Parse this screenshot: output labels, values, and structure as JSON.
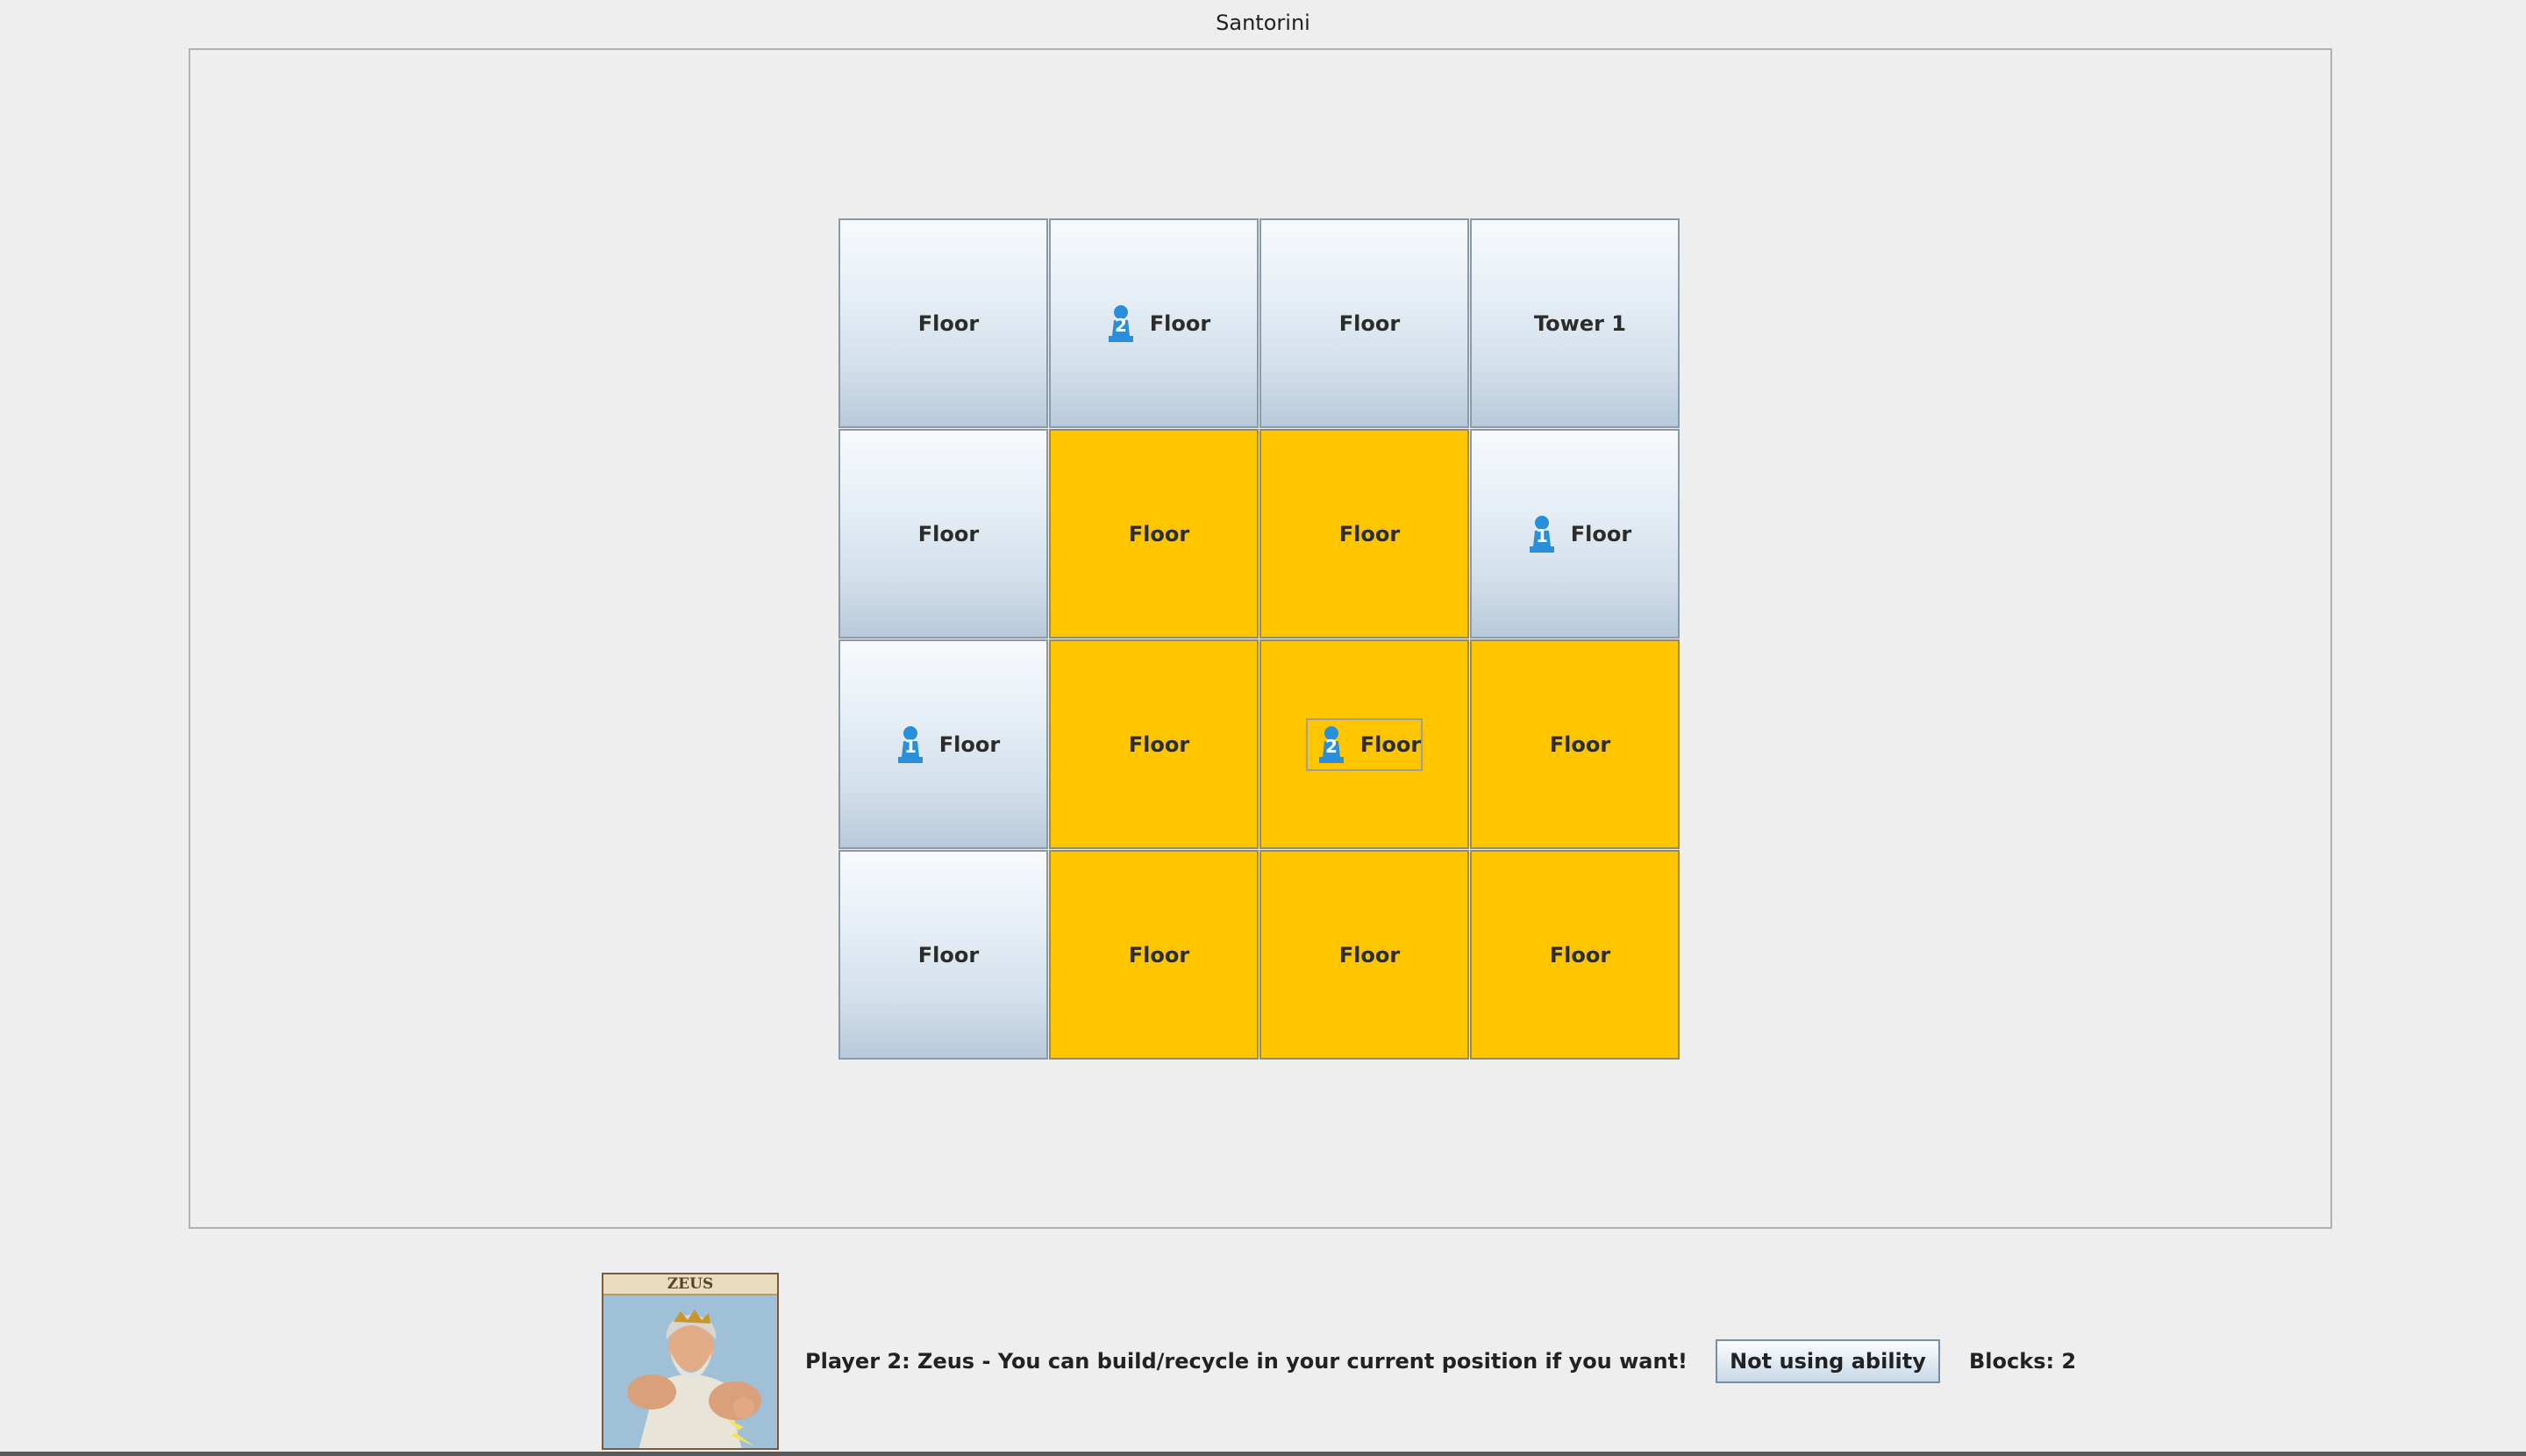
{
  "window": {
    "title": "Santorini"
  },
  "board": {
    "rows": [
      [
        {
          "label": "Floor",
          "highlight": false,
          "worker": null
        },
        {
          "label": "Floor",
          "highlight": false,
          "worker": "2"
        },
        {
          "label": "Floor",
          "highlight": false,
          "worker": null
        },
        {
          "label": "Tower 1",
          "highlight": false,
          "worker": null
        }
      ],
      [
        {
          "label": "Floor",
          "highlight": false,
          "worker": null
        },
        {
          "label": "Floor",
          "highlight": true,
          "worker": null
        },
        {
          "label": "Floor",
          "highlight": true,
          "worker": null
        },
        {
          "label": "Floor",
          "highlight": false,
          "worker": "1"
        }
      ],
      [
        {
          "label": "Floor",
          "highlight": false,
          "worker": "1"
        },
        {
          "label": "Floor",
          "highlight": true,
          "worker": null
        },
        {
          "label": "Floor",
          "highlight": true,
          "worker": "2",
          "selected": true
        },
        {
          "label": "Floor",
          "highlight": true,
          "worker": null
        }
      ],
      [
        {
          "label": "Floor",
          "highlight": false,
          "worker": null
        },
        {
          "label": "Floor",
          "highlight": true,
          "worker": null
        },
        {
          "label": "Floor",
          "highlight": true,
          "worker": null
        },
        {
          "label": "Floor",
          "highlight": true,
          "worker": null
        }
      ]
    ]
  },
  "colors": {
    "highlight": "#ffc600",
    "worker": "#2a8fd8"
  },
  "footer": {
    "god_card": {
      "name": "ZEUS",
      "icon": "zeus-card-image"
    },
    "status": "Player 2: Zeus - You can build/recycle in your current position if you want!",
    "ability_button": "Not using ability",
    "blocks": "Blocks: 2"
  }
}
